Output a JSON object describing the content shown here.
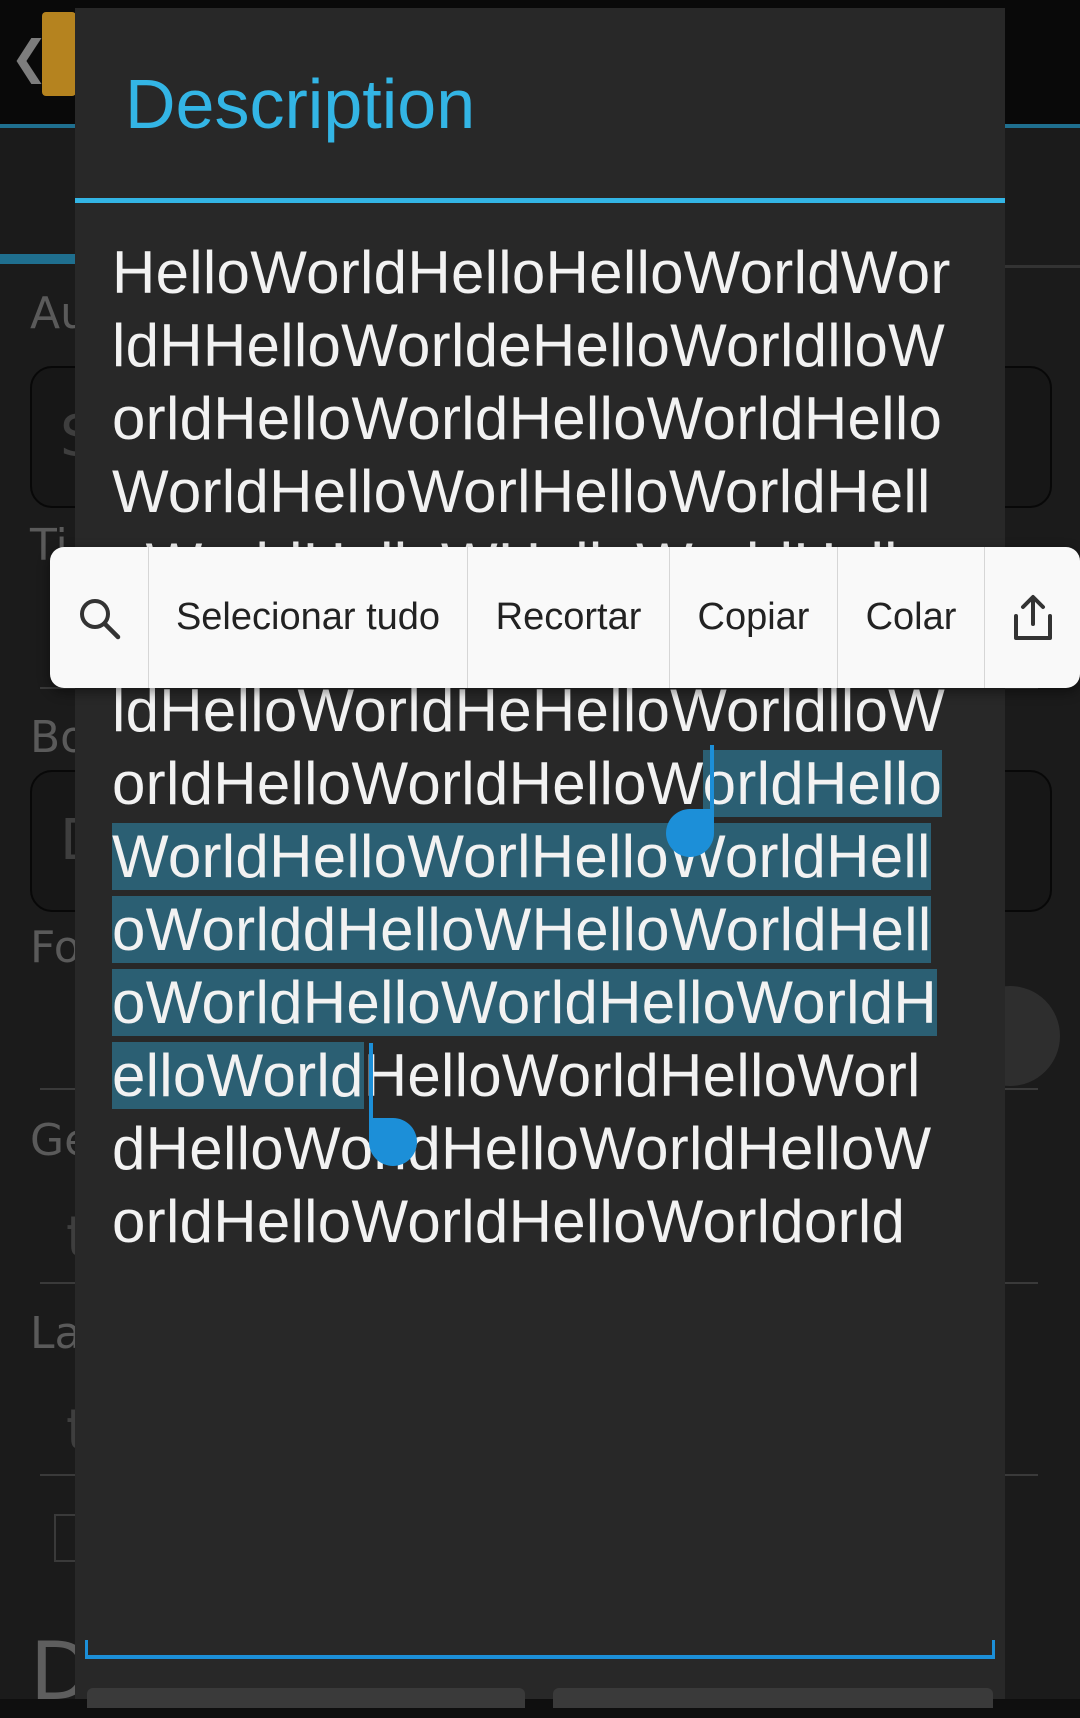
{
  "dialog": {
    "title": "Description",
    "description_lines": [
      {
        "before": "HelloWorldHelloHelloWorldWor",
        "selected": "",
        "after": ""
      },
      {
        "before": "ldHHelloWorldeHelloWorldlloW",
        "selected": "",
        "after": ""
      },
      {
        "before": "orldHelloWorldHelloWorldHello",
        "selected": "",
        "after": ""
      },
      {
        "before": "WorldHelloWorlHelloWorldHell",
        "selected": "",
        "after": ""
      },
      {
        "before": "oWorldHelloWHelloWorldHell",
        "selected": "",
        "after": ""
      },
      {
        "before": "",
        "selected": "",
        "after": ""
      },
      {
        "before": "ldHelloWorldHeHelloWorldlloW",
        "selected": "",
        "after": ""
      },
      {
        "before": "orldHelloWorldHelloW",
        "selected": "orldHello",
        "after": ""
      },
      {
        "before": "",
        "selected": "WorldHelloWorlHelloWorldHell",
        "after": ""
      },
      {
        "before": "",
        "selected": "oWorlddHelloWHelloWorldHell",
        "after": ""
      },
      {
        "before": "",
        "selected": "oWorldHelloWorldHelloWorldH",
        "after": ""
      },
      {
        "before": "",
        "selected": "elloWorld",
        "after": "HelloWorldHelloWorl"
      },
      {
        "before": "dHelloWorldHelloWorldHelloW",
        "selected": "",
        "after": ""
      },
      {
        "before": "orldHelloWorldHelloWorldorld",
        "selected": "",
        "after": ""
      }
    ]
  },
  "toolbar": {
    "search_icon": "search-icon",
    "select_all": "Selecionar tudo",
    "cut": "Recortar",
    "copy": "Copiar",
    "paste": "Colar",
    "share_icon": "share-icon"
  },
  "colors": {
    "accent": "#33b5e5",
    "selection": "#2b5f73",
    "handle": "#1c8fd8",
    "dialog_bg": "#282828"
  }
}
